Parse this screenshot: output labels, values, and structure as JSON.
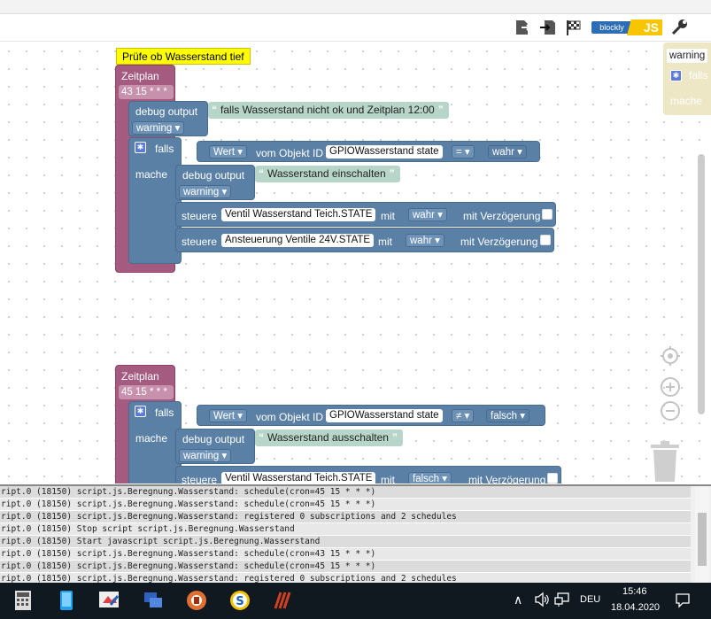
{
  "toolbar": {
    "blockly_label": "blockly",
    "js_label": "JS"
  },
  "comment1": "Prüfe ob Wasserstand tief",
  "schedule1": {
    "title": "Zeitplan",
    "cron": "43 15 * * *",
    "debug_label": "debug output",
    "debug_text": "falls Wasserstand nicht ok und Zeitplan 12:00",
    "level": "warning",
    "if_label": "falls",
    "value_dd": "Wert",
    "of_object_id": "vom Objekt ID",
    "object": "GPIOWasserstand state",
    "op": "=",
    "compare": "wahr",
    "do_label": "mache",
    "inner_debug_label": "debug output",
    "inner_debug_text": "Wasserstand einschalten",
    "inner_level": "warning",
    "ctrl1_label": "steuere",
    "ctrl1_obj": "Ventil Wasserstand Teich.STATE",
    "with_label": "mit",
    "ctrl1_val": "wahr",
    "delay_label": "mit Verzögerung",
    "ctrl2_label": "steuere",
    "ctrl2_obj": "Ansteuerung Ventile 24V.STATE",
    "ctrl2_val": "wahr"
  },
  "schedule2": {
    "title": "Zeitplan",
    "cron": "45 15 * * *",
    "if_label": "falls",
    "value_dd": "Wert",
    "of_object_id": "vom Objekt ID",
    "object": "GPIOWasserstand state",
    "op": "≠",
    "compare": "falsch",
    "do_label": "mache",
    "inner_debug_label": "debug output",
    "inner_debug_text": "Wasserstand ausschalten",
    "inner_level": "warning",
    "ctrl1_label": "steuere",
    "ctrl1_obj": "Ventil Wasserstand Teich.STATE",
    "with_label": "mit",
    "ctrl1_val": "falsch",
    "delay_label": "mit Verzögerung"
  },
  "partial_right": {
    "level": "warning",
    "if_label": "falls",
    "do_label": "mache"
  },
  "log_lines": [
    "ript.0 (18150) script.js.Beregnung.Wasserstand: schedule(cron=45 15 * * *)",
    "ript.0 (18150) script.js.Beregnung.Wasserstand: schedule(cron=45 15 * * *)",
    "ript.0 (18150) script.js.Beregnung.Wasserstand: registered 0 subscriptions and 2 schedules",
    "ript.0 (18150) Stop script script.js.Beregnung.Wasserstand",
    "ript.0 (18150) Start javascript script.js.Beregnung.Wasserstand",
    "ript.0 (18150) script.js.Beregnung.Wasserstand: schedule(cron=43 15 * * *)",
    "ript.0 (18150) script.js.Beregnung.Wasserstand: schedule(cron=45 15 * * *)",
    "ript.0 (18150) script.js.Beregnung.Wasserstand: registered 0 subscriptions and 2 schedules"
  ],
  "taskbar": {
    "language": "DEU",
    "time": "15:46",
    "date": "18.04.2020"
  }
}
